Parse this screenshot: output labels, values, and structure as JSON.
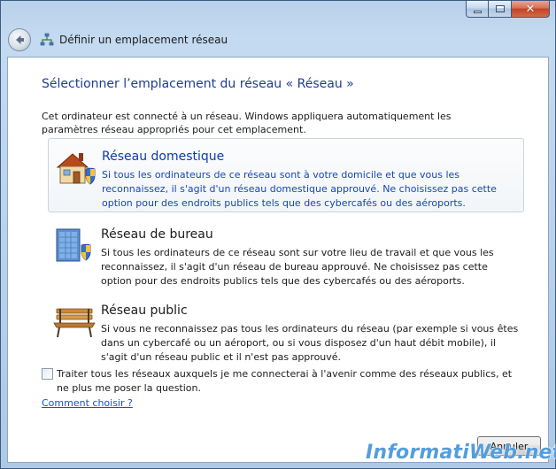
{
  "window": {
    "title": "Définir un emplacement réseau",
    "close_glyph": "✕"
  },
  "content": {
    "heading": "Sélectionner l’emplacement du réseau « Réseau »",
    "intro": "Cet ordinateur est connecté à un réseau. Windows appliquera automatiquement les paramètres réseau appropriés pour cet emplacement.",
    "options": [
      {
        "title": "Réseau domestique",
        "description": "Si tous les ordinateurs de ce réseau sont à votre domicile et que vous les reconnaissez, il s'agit d'un réseau domestique approuvé. Ne choisissez pas cette option pour des endroits publics tels que des cybercafés ou des aéroports.",
        "icon": "house-shield-icon",
        "selected": true
      },
      {
        "title": "Réseau de bureau",
        "description": "Si tous les ordinateurs de ce réseau sont sur votre lieu de travail et que vous les reconnaissez, il s'agit d'un réseau de bureau approuvé. Ne choisissez pas cette option pour des endroits publics tels que des cybercafés ou des aéroports.",
        "icon": "office-building-shield-icon",
        "selected": false
      },
      {
        "title": "Réseau public",
        "description": "Si vous ne reconnaissez pas tous les ordinateurs du réseau (par exemple si vous êtes dans un cybercafé ou un aéroport, ou si vous disposez d'un haut débit mobile), il s'agit d'un réseau public et il n'est pas approuvé.",
        "icon": "park-bench-icon",
        "selected": false
      }
    ],
    "checkbox_label": "Traiter tous les réseaux auxquels je me connecterai à l'avenir comme des réseaux publics, et ne plus me poser la question.",
    "checkbox_checked": false,
    "help_link": "Comment choisir ?",
    "cancel_label": "Annuler"
  },
  "watermark": "InformatiWeb.net",
  "colors": {
    "heading": "#1f3d8f",
    "link": "#0f56c9",
    "selected_text": "#1846b6"
  }
}
